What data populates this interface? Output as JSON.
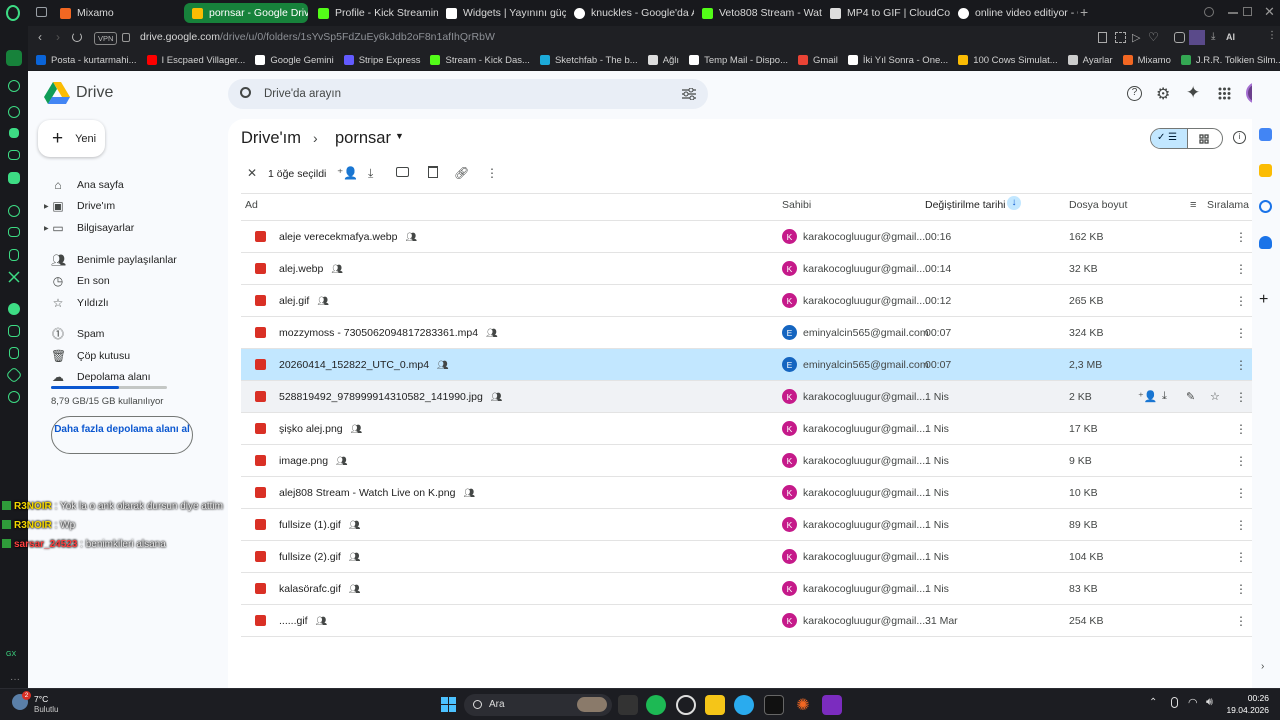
{
  "browser": {
    "tabs": [
      {
        "title": "Mixamo",
        "color": "#f26722"
      },
      {
        "title": "pornsar - Google Drive",
        "color": "#fbbc04",
        "active": true
      },
      {
        "title": "Profile - Kick Streaming",
        "color": "#53fc18"
      },
      {
        "title": "Widgets | Yayınını güçlendi",
        "color": "#ffffff"
      },
      {
        "title": "knuckles - Google'da Ara",
        "color": "#ffffff"
      },
      {
        "title": "Veto808 Stream - Watch L",
        "color": "#53fc18"
      },
      {
        "title": "MP4 to GIF | CloudConvert",
        "color": "#dddddd"
      },
      {
        "title": "online video editiyor - Goo",
        "color": "#ffffff"
      }
    ],
    "url_domain": "drive.google.com",
    "url_path": "/drive/u/0/folders/1sYvSp5FdZuEy6kJdb2oF8n1afIhQrRbW",
    "vpn_label": "VPN",
    "ai_label": "AI",
    "bookmarks": [
      {
        "label": "Posta - kurtarmahi...",
        "color": "#0a64d8"
      },
      {
        "label": "I Escpaed Villager...",
        "color": "#ff0000"
      },
      {
        "label": "Google Gemini",
        "color": "#ffffff"
      },
      {
        "label": "Stripe Express",
        "color": "#635bff"
      },
      {
        "label": "Stream - Kick Das...",
        "color": "#53fc18"
      },
      {
        "label": "Sketchfab - The b...",
        "color": "#1caad9"
      },
      {
        "label": "Ağlı",
        "color": "#dddddd"
      },
      {
        "label": "Temp Mail - Dispo...",
        "color": "#ffffff"
      },
      {
        "label": "Gmail",
        "color": "#ea4335"
      },
      {
        "label": "İki Yıl Sonra - One...",
        "color": "#ffffff"
      },
      {
        "label": "100 Cows Simulat...",
        "color": "#fbbc04"
      },
      {
        "label": "Ayarlar",
        "color": "#cccccc"
      },
      {
        "label": "Mixamo",
        "color": "#f26722"
      },
      {
        "label": "J.R.R. Tolkien Silm...",
        "color": "#34a853"
      }
    ]
  },
  "drive": {
    "logo_text": "Drive",
    "search_placeholder": "Drive'da arayın",
    "new_button": "Yeni",
    "nav": [
      {
        "label": "Ana sayfa",
        "icon": "home-icon"
      },
      {
        "label": "Drive'ım",
        "icon": "drive-icon"
      },
      {
        "label": "Bilgisayarlar",
        "icon": "computer-icon"
      },
      {
        "label": "Benimle paylaşılanlar",
        "icon": "shared-icon"
      },
      {
        "label": "En son",
        "icon": "clock-icon"
      },
      {
        "label": "Yıldızlı",
        "icon": "star-icon"
      },
      {
        "label": "Spam",
        "icon": "spam-icon"
      },
      {
        "label": "Çöp kutusu",
        "icon": "trash-icon"
      },
      {
        "label": "Depolama alanı",
        "icon": "cloud-icon"
      }
    ],
    "storage_text": "8,79 GB/15 GB kullanılıyor",
    "storage_fraction": 0.586,
    "get_storage_button": "Daha fazla depolama alanı al",
    "breadcrumb_root": "Drive'ım",
    "breadcrumb_current": "pornsar",
    "selection_text": "1 öğe seçildi",
    "columns": {
      "name": "Ad",
      "owner": "Sahibi",
      "modified": "Değiştirilme tarihi",
      "size": "Dosya boyut",
      "sort": "Sıralama"
    },
    "files": [
      {
        "name": "aleje verecekmafya.webp",
        "type": "image",
        "owner": "karakocogluugur@gmail....",
        "owner_initial": "K",
        "modified": "00:16",
        "size": "162 KB"
      },
      {
        "name": "alej.webp",
        "type": "image",
        "owner": "karakocogluugur@gmail....",
        "owner_initial": "K",
        "modified": "00:14",
        "size": "32 KB"
      },
      {
        "name": "alej.gif",
        "type": "image",
        "owner": "karakocogluugur@gmail....",
        "owner_initial": "K",
        "modified": "00:12",
        "size": "265 KB"
      },
      {
        "name": "mozzymoss - 7305062094817283361.mp4",
        "type": "video",
        "owner": "eminyalcin565@gmail.com",
        "owner_initial": "E",
        "modified": "00:07",
        "size": "324 KB"
      },
      {
        "name": "20260414_152822_UTC_0.mp4",
        "type": "video",
        "owner": "eminyalcin565@gmail.com",
        "owner_initial": "E",
        "modified": "00:07",
        "size": "2,3 MB",
        "selected": true
      },
      {
        "name": "528819492_978999914310582_141990.jpg",
        "type": "image",
        "owner": "karakocogluugur@gmail....",
        "owner_initial": "K",
        "modified": "1 Nis",
        "size": "2 KB",
        "hover": true
      },
      {
        "name": "şişko alej.png",
        "type": "image",
        "owner": "karakocogluugur@gmail....",
        "owner_initial": "K",
        "modified": "1 Nis",
        "size": "17 KB"
      },
      {
        "name": "image.png",
        "type": "image",
        "owner": "karakocogluugur@gmail....",
        "owner_initial": "K",
        "modified": "1 Nis",
        "size": "9 KB"
      },
      {
        "name": "alej808 Stream - Watch Live on K.png",
        "type": "image",
        "owner": "karakocogluugur@gmail....",
        "owner_initial": "K",
        "modified": "1 Nis",
        "size": "10 KB"
      },
      {
        "name": "fullsize (1).gif",
        "type": "image",
        "owner": "karakocogluugur@gmail....",
        "owner_initial": "K",
        "modified": "1 Nis",
        "size": "89 KB"
      },
      {
        "name": "fullsize (2).gif",
        "type": "image",
        "owner": "karakocogluugur@gmail....",
        "owner_initial": "K",
        "modified": "1 Nis",
        "size": "104 KB"
      },
      {
        "name": "kalasörafc.gif",
        "type": "image",
        "owner": "karakocogluugur@gmail....",
        "owner_initial": "K",
        "modified": "1 Nis",
        "size": "83 KB"
      },
      {
        "name": "......gif",
        "type": "image",
        "owner": "karakocogluugur@gmail....",
        "owner_initial": "K",
        "modified": "31 Mar",
        "size": "254 KB"
      }
    ]
  },
  "overlay_chat": [
    {
      "user": "R3NOIR",
      "message": " : Yok la o ank olarak dursun diye attim"
    },
    {
      "user": "R3NOIR",
      "message": " : Wp"
    },
    {
      "user": "sarsar_24523",
      "message": " : benimkileri alsana"
    }
  ],
  "taskbar": {
    "weather_temp": "7°C",
    "weather_text": "Bulutlu",
    "weather_badge": "2",
    "search_label": "Ara",
    "time": "00:26",
    "date": "19.04.2026"
  },
  "colors": {
    "accent_blue": "#0b57d0",
    "selected_row": "#c2e7ff",
    "avatar_k": "#c51a8a",
    "avatar_e": "#1565c0",
    "file_red": "#d93025"
  }
}
